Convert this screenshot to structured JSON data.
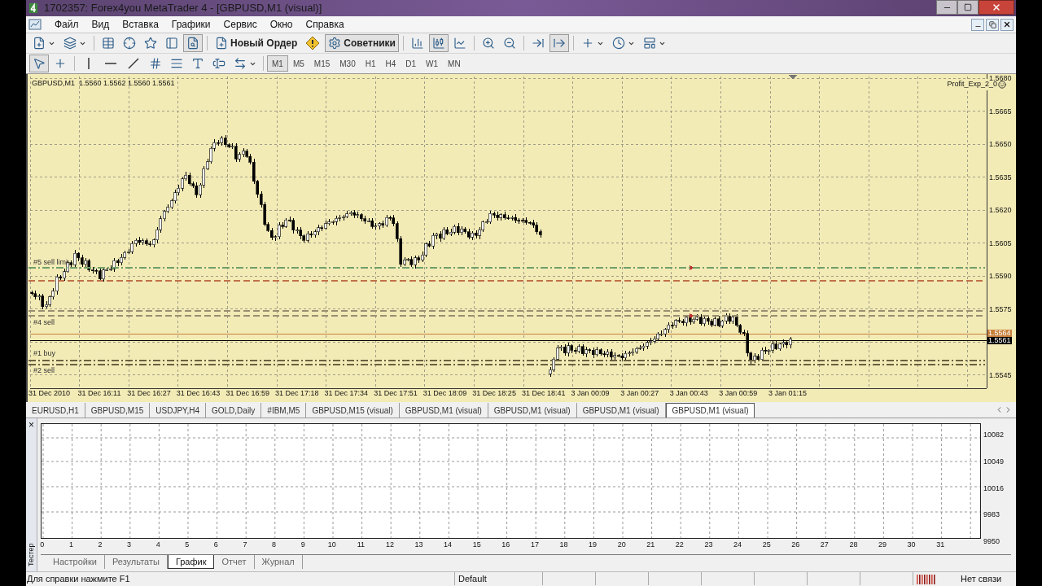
{
  "window": {
    "title": "1702357: Forex4you MetaTrader 4 - [GBPUSD,M1 (visual)]"
  },
  "menu": [
    "Файл",
    "Вид",
    "Вставка",
    "Графики",
    "Сервис",
    "Окно",
    "Справка"
  ],
  "toolbar": [
    {
      "kind": "icon",
      "selected": false,
      "dropdown": true
    },
    {
      "kind": "icon",
      "selected": false,
      "dropdown": true
    },
    {
      "kind": "separator"
    },
    {
      "kind": "icon",
      "selected": false
    },
    {
      "kind": "icon",
      "selected": false
    },
    {
      "kind": "icon",
      "selected": false
    },
    {
      "kind": "icon",
      "selected": false
    },
    {
      "kind": "icon",
      "selected": true
    },
    {
      "kind": "separator"
    },
    {
      "kind": "text",
      "label": "Новый Ордер",
      "selected": false
    },
    {
      "kind": "icon",
      "selected": false
    },
    {
      "kind": "text",
      "label": "Советники",
      "selected": true
    },
    {
      "kind": "separator"
    },
    {
      "kind": "icon",
      "selected": false
    },
    {
      "kind": "icon",
      "selected": true
    },
    {
      "kind": "icon",
      "selected": false
    },
    {
      "kind": "separator"
    },
    {
      "kind": "icon",
      "selected": false
    },
    {
      "kind": "icon",
      "selected": false
    },
    {
      "kind": "separator"
    },
    {
      "kind": "icon",
      "selected": false
    },
    {
      "kind": "icon",
      "selected": true
    },
    {
      "kind": "separator"
    },
    {
      "kind": "icon",
      "selected": false,
      "dropdown": true
    },
    {
      "kind": "icon",
      "selected": false,
      "dropdown": true
    },
    {
      "kind": "icon",
      "selected": false,
      "dropdown": true
    }
  ],
  "drawing_toolbar": [
    {
      "kind": "icon",
      "selected": true
    },
    {
      "kind": "icon",
      "selected": false
    },
    {
      "kind": "separator"
    },
    {
      "kind": "icon",
      "selected": false
    },
    {
      "kind": "icon",
      "selected": false
    },
    {
      "kind": "icon",
      "selected": false
    },
    {
      "kind": "icon",
      "selected": false
    },
    {
      "kind": "icon",
      "selected": false
    },
    {
      "kind": "icon",
      "selected": false
    },
    {
      "kind": "icon",
      "selected": false
    },
    {
      "kind": "icon",
      "selected": false,
      "dropdown": true
    }
  ],
  "timeframes": [
    {
      "label": "M1",
      "selected": true
    },
    {
      "label": "M5",
      "selected": false
    },
    {
      "label": "M15",
      "selected": false
    },
    {
      "label": "M30",
      "selected": false
    },
    {
      "label": "H1",
      "selected": false
    },
    {
      "label": "H4",
      "selected": false
    },
    {
      "label": "D1",
      "selected": false
    },
    {
      "label": "W1",
      "selected": false
    },
    {
      "label": "MN",
      "selected": false
    }
  ],
  "chart": {
    "header": "GBPUSD,M1  1.5560 1.5562 1.5560 1.5561",
    "expert": "Profit_Exp_2_0",
    "price_ticks": [
      "1.5680",
      "1.5665",
      "1.5650",
      "1.5635",
      "1.5620",
      "1.5605",
      "1.5590",
      "1.5575",
      "1.5545"
    ],
    "time_ticks": [
      "31 Dec 2010",
      "31 Dec 16:11",
      "31 Dec 16:27",
      "31 Dec 16:43",
      "31 Dec 16:59",
      "31 Dec 17:18",
      "31 Dec 17:34",
      "31 Dec 17:51",
      "31 Dec 18:09",
      "31 Dec 18:25",
      "31 Dec 18:41",
      "3 Jan 00:09",
      "3 Jan 00:27",
      "3 Jan 00:43",
      "3 Jan 00:59",
      "3 Jan 01:15"
    ],
    "order_lines": [
      {
        "label": "#5 sell limi",
        "kind": "dashdot",
        "color": "#6f9f6a"
      },
      {
        "kind": "dashed",
        "color": "#c0704a"
      },
      {
        "label": "#4 sell",
        "kind": "dashed",
        "color": "#9a8f72"
      },
      {
        "kind": "dashed",
        "color": "#9a8f72"
      },
      {
        "label": "#1 buy",
        "kind": "dashdot",
        "color": "#6b6140"
      },
      {
        "label": "#2 sell",
        "kind": "dashdot",
        "color": "#6b6140"
      }
    ],
    "price_marks": [
      {
        "label": "1.5564",
        "color": "#c8803c"
      },
      {
        "label": "1.5561",
        "color": "#000000"
      }
    ]
  },
  "chart_tabs": [
    {
      "label": "EURUSD,H1",
      "selected": false
    },
    {
      "label": "GBPUSD,M15",
      "selected": false
    },
    {
      "label": "USDJPY,H4",
      "selected": false
    },
    {
      "label": "GOLD,Daily",
      "selected": false
    },
    {
      "label": "#IBM,M5",
      "selected": false
    },
    {
      "label": "GBPUSD,M15 (visual)",
      "selected": false
    },
    {
      "label": "GBPUSD,M1 (visual)",
      "selected": false
    },
    {
      "label": "GBPUSD,M1 (visual)",
      "selected": false
    },
    {
      "label": "GBPUSD,M1 (visual)",
      "selected": false
    },
    {
      "label": "GBPUSD,M1 (visual)",
      "selected": true
    }
  ],
  "tester": {
    "side_label": "Тестер",
    "close": "×",
    "x_ticks": [
      "0",
      "1",
      "2",
      "3",
      "4",
      "5",
      "6",
      "7",
      "8",
      "9",
      "10",
      "11",
      "12",
      "13",
      "14",
      "15",
      "16",
      "17",
      "18",
      "19",
      "20",
      "21",
      "22",
      "23",
      "24",
      "25",
      "26",
      "27",
      "28",
      "29",
      "30",
      "31"
    ],
    "y_ticks": [
      "10082",
      "10049",
      "10016",
      "9983",
      "9950"
    ],
    "tabs": [
      {
        "label": "Настройки",
        "selected": false
      },
      {
        "label": "Результаты",
        "selected": false
      },
      {
        "label": "График",
        "selected": true
      },
      {
        "label": "Отчет",
        "selected": false
      },
      {
        "label": "Журнал",
        "selected": false
      }
    ]
  },
  "status_bar": {
    "help": "Для справки нажмите F1",
    "profile": "Default",
    "connection": "Нет связи"
  }
}
